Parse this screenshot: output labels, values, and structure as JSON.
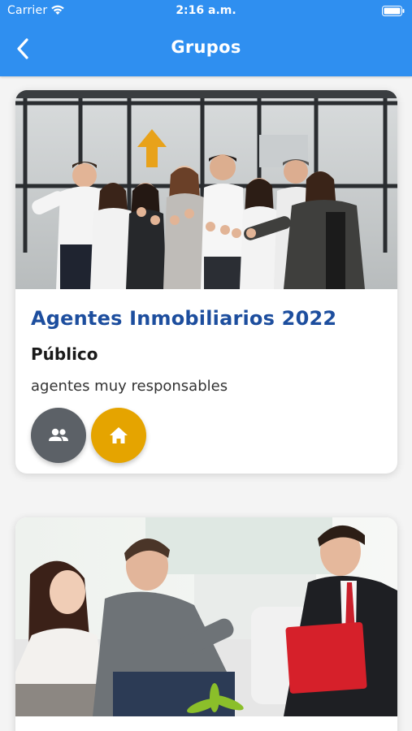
{
  "status_bar": {
    "carrier": "Carrier",
    "time": "2:16 a.m."
  },
  "nav": {
    "title": "Grupos",
    "back_icon": "chevron-left-icon"
  },
  "groups": [
    {
      "title": "Agentes Inmobiliarios 2022",
      "privacy": "Público",
      "description": "agentes muy responsables",
      "image": "team-office-photo",
      "actions": [
        {
          "icon": "members-icon",
          "color": "#5c6167"
        },
        {
          "icon": "home-icon",
          "color": "#e5a400"
        }
      ]
    },
    {
      "image": "agent-meeting-clients-photo"
    }
  ],
  "colors": {
    "nav_bar": "#2f8ff0",
    "group_title": "#1d4e9e",
    "members_button": "#5c6167",
    "home_button": "#e5a400"
  }
}
